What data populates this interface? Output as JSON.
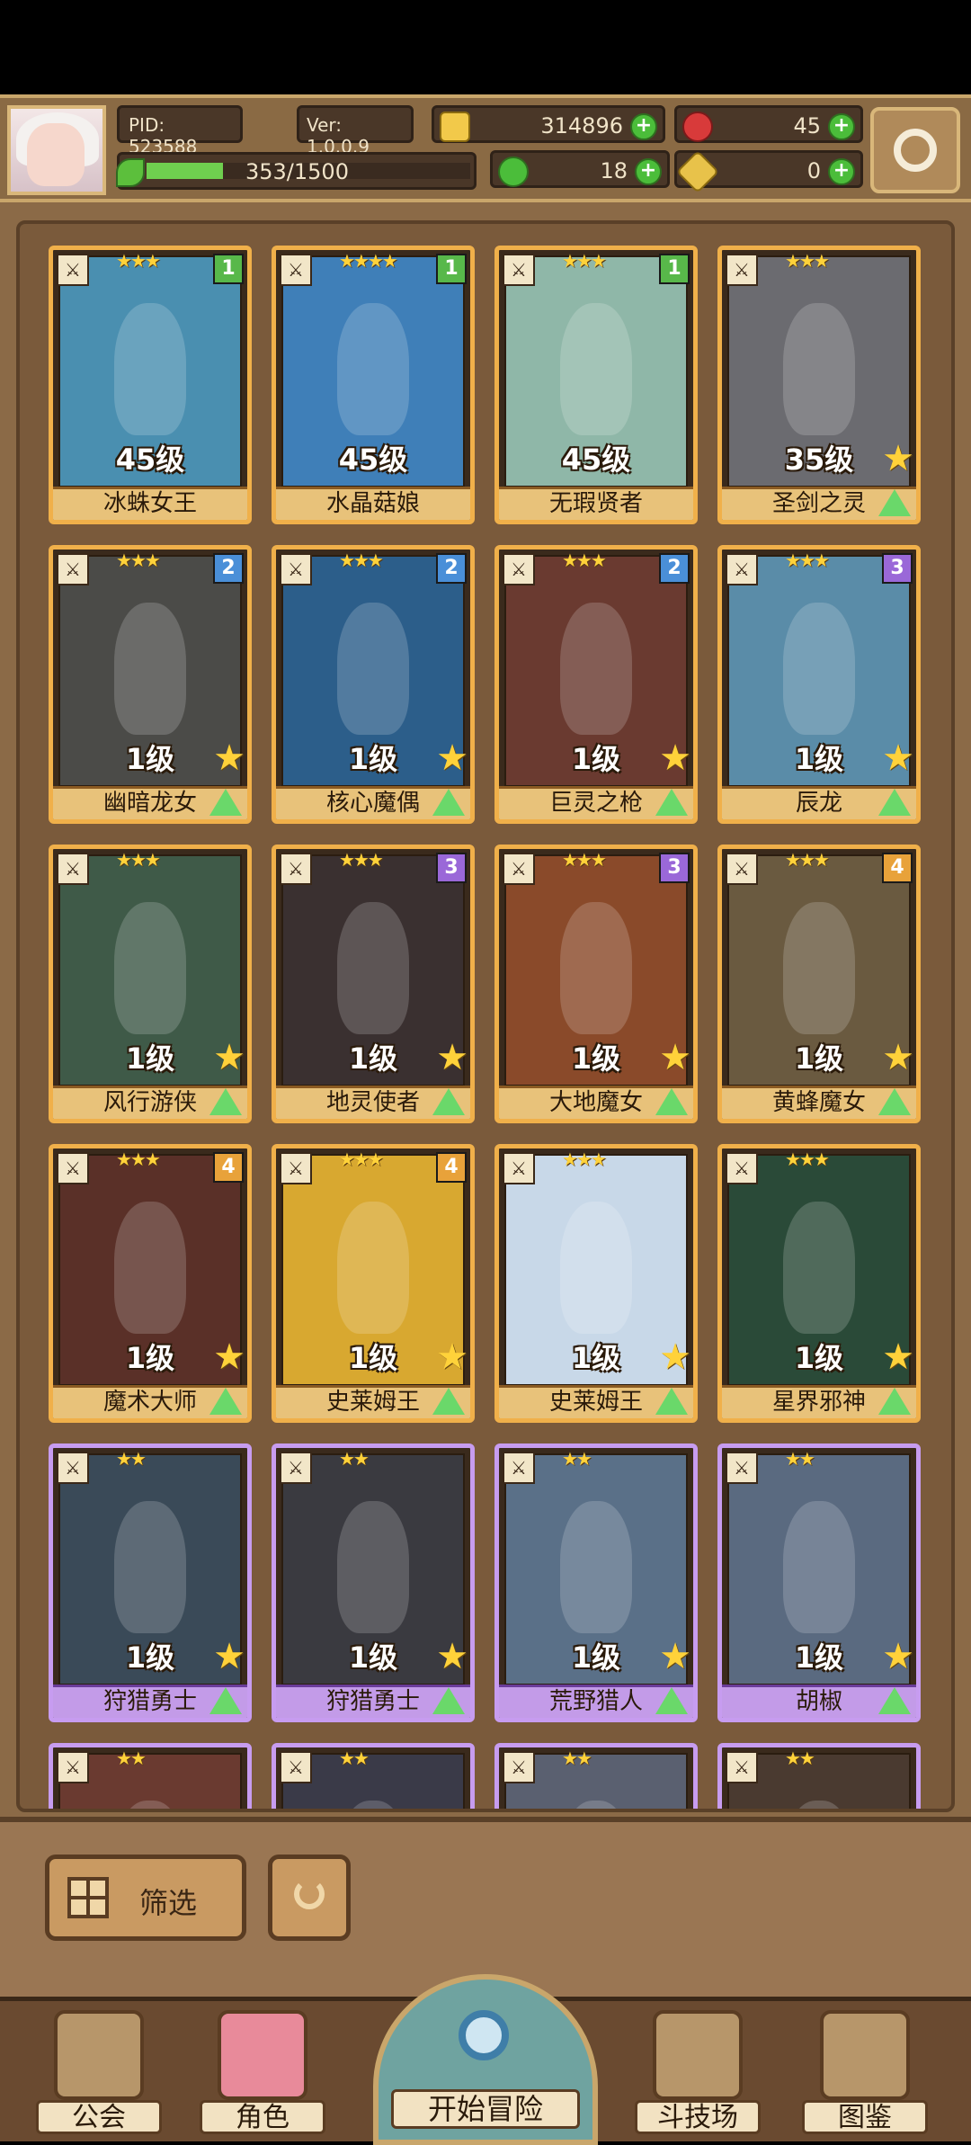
{
  "hud": {
    "pid": "PID: 523588",
    "version": "Ver: 1.0.0.9",
    "gold": "314896",
    "gems": "45",
    "energy_text": "353/1500",
    "energy_fraction": 0.235,
    "clover": "18",
    "keys": "0",
    "plus": "+"
  },
  "cards": [
    {
      "name": "冰蛛女王",
      "level": "45级",
      "tier": "1",
      "stars": "★★★",
      "frame": "gold",
      "art": "#4a8fb0",
      "tier_color": "#58b84a"
    },
    {
      "name": "水晶菇娘",
      "level": "45级",
      "tier": "1",
      "stars": "★★★★",
      "frame": "gold",
      "art": "#3f7fb8",
      "tier_color": "#58b84a"
    },
    {
      "name": "无瑕贤者",
      "level": "45级",
      "tier": "1",
      "stars": "★★★",
      "frame": "gold",
      "art": "#8fb7a8",
      "tier_color": "#58b84a"
    },
    {
      "name": "圣剑之灵",
      "level": "35级",
      "tier": "",
      "stars": "★★★",
      "frame": "gold",
      "art": "#6b6b70",
      "tier_color": ""
    },
    {
      "name": "幽暗龙女",
      "level": "1级",
      "tier": "2",
      "stars": "★★★",
      "frame": "gold",
      "art": "#4b4b48",
      "tier_color": "#4a8fd8"
    },
    {
      "name": "核心魔偶",
      "level": "1级",
      "tier": "2",
      "stars": "★★★",
      "frame": "gold",
      "art": "#2c5e8a",
      "tier_color": "#4a8fd8"
    },
    {
      "name": "巨灵之枪",
      "level": "1级",
      "tier": "2",
      "stars": "★★★",
      "frame": "gold",
      "art": "#6a3a30",
      "tier_color": "#4a8fd8"
    },
    {
      "name": "辰龙",
      "level": "1级",
      "tier": "3",
      "stars": "★★★",
      "frame": "gold",
      "art": "#5a8ca8",
      "tier_color": "#9a68d8"
    },
    {
      "name": "风行游侠",
      "level": "1级",
      "tier": "",
      "stars": "★★★",
      "frame": "gold",
      "art": "#3f5a48",
      "tier_color": ""
    },
    {
      "name": "地灵使者",
      "level": "1级",
      "tier": "3",
      "stars": "★★★",
      "frame": "gold",
      "art": "#3a3030",
      "tier_color": "#9a68d8"
    },
    {
      "name": "大地魔女",
      "level": "1级",
      "tier": "3",
      "stars": "★★★",
      "frame": "gold",
      "art": "#8a4a2a",
      "tier_color": "#9a68d8"
    },
    {
      "name": "黄蜂魔女",
      "level": "1级",
      "tier": "4",
      "stars": "★★★",
      "frame": "gold",
      "art": "#6a5a40",
      "tier_color": "#e8a23a"
    },
    {
      "name": "魔术大师",
      "level": "1级",
      "tier": "4",
      "stars": "★★★",
      "frame": "gold",
      "art": "#5a3028",
      "tier_color": "#e8a23a"
    },
    {
      "name": "史莱姆王",
      "level": "1级",
      "tier": "4",
      "stars": "★★★",
      "frame": "gold",
      "art": "#d8a830",
      "tier_color": "#e8a23a"
    },
    {
      "name": "史莱姆王",
      "level": "1级",
      "tier": "",
      "stars": "★★★",
      "frame": "gold",
      "art": "#c8d8e8",
      "tier_color": ""
    },
    {
      "name": "星界邪神",
      "level": "1级",
      "tier": "",
      "stars": "★★★",
      "frame": "gold",
      "art": "#2a4a38",
      "tier_color": ""
    },
    {
      "name": "狩猎勇士",
      "level": "1级",
      "tier": "",
      "stars": "★★",
      "frame": "purple",
      "art": "#3a4a58",
      "tier_color": ""
    },
    {
      "name": "狩猎勇士",
      "level": "1级",
      "tier": "",
      "stars": "★★",
      "frame": "purple",
      "art": "#3a3a40",
      "tier_color": ""
    },
    {
      "name": "荒野猎人",
      "level": "1级",
      "tier": "",
      "stars": "★★",
      "frame": "purple",
      "art": "#5a7088",
      "tier_color": ""
    },
    {
      "name": "胡椒",
      "level": "1级",
      "tier": "",
      "stars": "★★",
      "frame": "purple",
      "art": "#5a6a80",
      "tier_color": ""
    },
    {
      "name": "",
      "level": "",
      "tier": "",
      "stars": "★★",
      "frame": "purple",
      "art": "#6a3a30",
      "tier_color": ""
    },
    {
      "name": "",
      "level": "",
      "tier": "",
      "stars": "★★",
      "frame": "purple",
      "art": "#3a3a48",
      "tier_color": ""
    },
    {
      "name": "",
      "level": "",
      "tier": "",
      "stars": "★★",
      "frame": "purple",
      "art": "#5a6070",
      "tier_color": ""
    },
    {
      "name": "",
      "level": "",
      "tier": "",
      "stars": "★★",
      "frame": "purple",
      "art": "#4a3a30",
      "tier_color": ""
    }
  ],
  "controls": {
    "filter_label": "筛选"
  },
  "nav": {
    "guild": "公会",
    "characters": "角色",
    "start": "开始冒险",
    "arena": "斗技场",
    "codex": "图鉴"
  },
  "colors": {
    "gold_frame": "#f0b04a",
    "purple_frame": "#c79cf0",
    "accent_green": "#4bbd3a"
  }
}
